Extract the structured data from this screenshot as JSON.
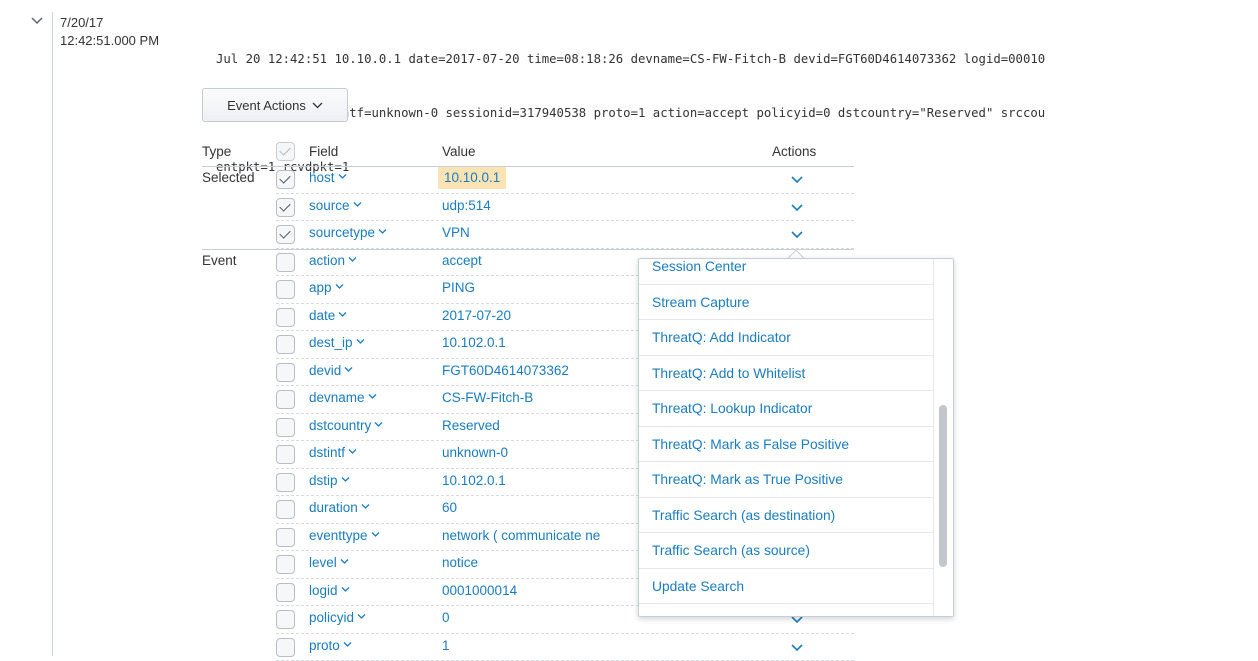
{
  "event": {
    "date": "7/20/17",
    "time": "12:42:51.000 PM",
    "raw_lines": [
      "Jul 20 12:42:51 10.10.0.1 date=2017-07-20 time=08:18:26 devname=CS-FW-Fitch-B devid=FGT60D4614073362 logid=00010",
      "p=10.102.0.1 dstintf=unknown-0 sessionid=317940538 proto=1 action=accept policyid=0 dstcountry=\"Reserved\" srccou",
      "entpkt=1 rcvdpkt=1"
    ]
  },
  "event_actions_button": "Event Actions",
  "table": {
    "headers": {
      "type": "Type",
      "field": "Field",
      "value": "Value",
      "actions": "Actions"
    },
    "group_labels": {
      "selected": "Selected",
      "event": "Event"
    },
    "rows": [
      {
        "field": "host",
        "value": "10.10.0.1",
        "checked": true,
        "group": "Selected",
        "highlight": true
      },
      {
        "field": "source",
        "value": "udp:514",
        "checked": true
      },
      {
        "field": "sourcetype",
        "value": "VPN",
        "checked": true
      },
      {
        "field": "action",
        "value": "accept",
        "checked": false,
        "group": "Event"
      },
      {
        "field": "app",
        "value": "PING",
        "checked": false
      },
      {
        "field": "date",
        "value": "2017-07-20",
        "checked": false
      },
      {
        "field": "dest_ip",
        "value": "10.102.0.1",
        "checked": false
      },
      {
        "field": "devid",
        "value": "FGT60D4614073362",
        "checked": false
      },
      {
        "field": "devname",
        "value": "CS-FW-Fitch-B",
        "checked": false
      },
      {
        "field": "dstcountry",
        "value": "Reserved",
        "checked": false
      },
      {
        "field": "dstintf",
        "value": "unknown-0",
        "checked": false
      },
      {
        "field": "dstip",
        "value": "10.102.0.1",
        "checked": false
      },
      {
        "field": "duration",
        "value": "60",
        "checked": false
      },
      {
        "field": "eventtype",
        "value": "network ( communicate  ne",
        "checked": false
      },
      {
        "field": "level",
        "value": "notice",
        "checked": false
      },
      {
        "field": "logid",
        "value": "0001000014",
        "checked": false
      },
      {
        "field": "policyid",
        "value": "0",
        "checked": false
      },
      {
        "field": "proto",
        "value": "1",
        "checked": false
      }
    ]
  },
  "actions_menu": {
    "items": [
      "Session Center",
      "Stream Capture",
      "ThreatQ: Add Indicator",
      "ThreatQ: Add to Whitelist",
      "ThreatQ: Lookup Indicator",
      "ThreatQ: Mark as False Positive",
      "ThreatQ: Mark as True Positive",
      "Traffic Search (as destination)",
      "Traffic Search (as source)",
      "Update Search"
    ]
  },
  "colors": {
    "link": "#1a7cc1",
    "highlight": "#fbe3b4"
  },
  "icons": {
    "expand": "chevron-down-icon",
    "field_caret": "caret-down-icon",
    "checkbox": "checkmark-icon"
  }
}
